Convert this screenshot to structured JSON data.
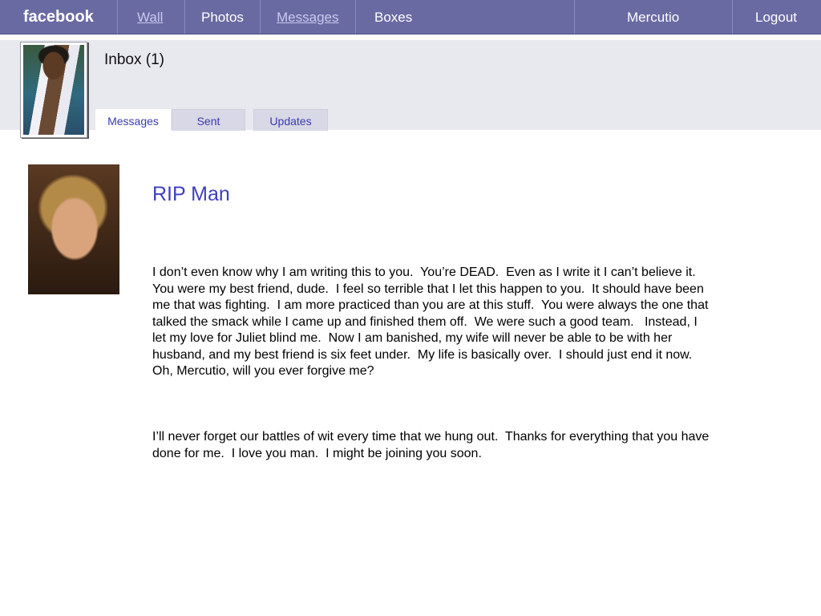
{
  "nav": {
    "logo": "facebook",
    "items": [
      {
        "label": "Wall",
        "link": true
      },
      {
        "label": "Photos",
        "link": false
      },
      {
        "label": "Messages",
        "link": true
      },
      {
        "label": "Boxes",
        "link": false
      }
    ],
    "user": "Mercutio",
    "logout": "Logout"
  },
  "header": {
    "inbox_title": "Inbox (1)",
    "tabs": [
      "Messages",
      "Sent",
      "Updates"
    ]
  },
  "message": {
    "subject": "RIP Man",
    "paragraphs": [
      "I don’t even know why I am writing this to you.  You’re DEAD.  Even as I write it I can’t believe it.  You were my best friend, dude.  I feel so terrible that I let this happen to you.  It should have been me that was fighting.  I am more practiced than you are at this stuff.  You were always the one that talked the smack while I came up and finished them off.  We were such a good team.   Instead, I let my love for Juliet blind me.  Now I am banished, my wife will never be able to be with her husband, and my best friend is six feet under.  My life is basically over.  I should just end it now.  Oh, Mercutio, will you ever forgive me?",
      "I’ll never forget our battles of wit every time that we hung out.  Thanks for everything that you have done for me.  I love you man.  I might be joining you soon."
    ]
  },
  "colors": {
    "topbar": "#6a6aa3",
    "accent": "#3f3fc0",
    "subheader": "#e8e8ef"
  }
}
